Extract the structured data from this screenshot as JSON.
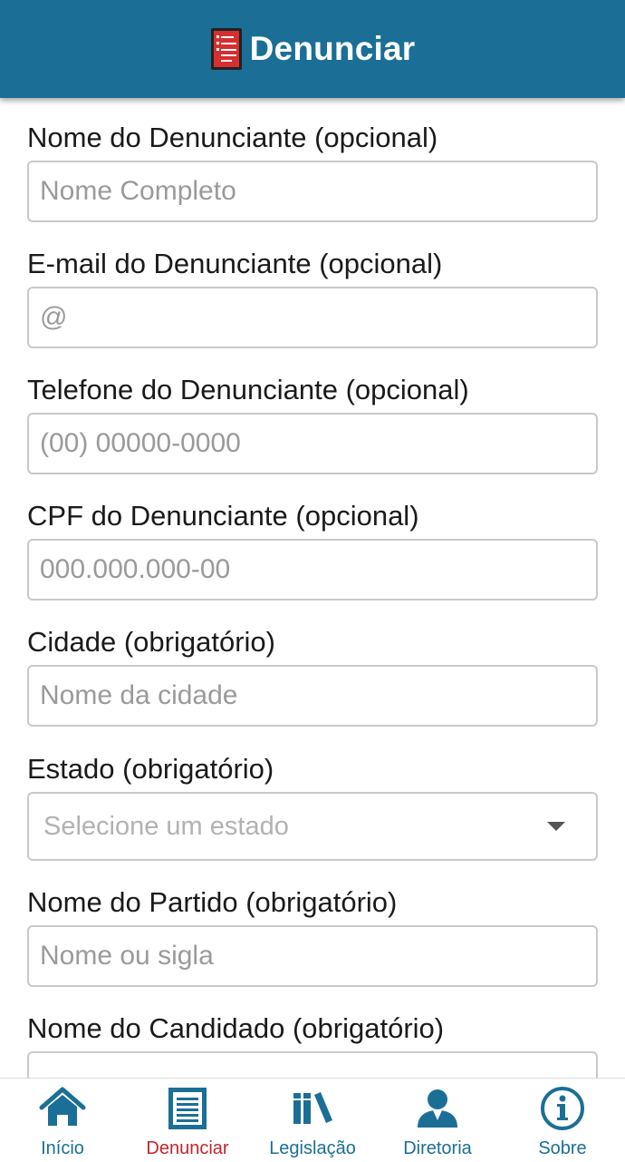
{
  "header": {
    "title": "Denunciar",
    "icon": "report-form-icon"
  },
  "form": {
    "fields": [
      {
        "label": "Nome do Denunciante (opcional)",
        "placeholder": "Nome Completo",
        "value": ""
      },
      {
        "label": "E-mail do Denunciante (opcional)",
        "placeholder": "@",
        "value": ""
      },
      {
        "label": "Telefone do Denunciante (opcional)",
        "placeholder": "(00) 00000-0000",
        "value": ""
      },
      {
        "label": "CPF do Denunciante (opcional)",
        "placeholder": "000.000.000-00",
        "value": ""
      },
      {
        "label": "Cidade (obrigatório)",
        "placeholder": "Nome da cidade",
        "value": ""
      },
      {
        "label": "Estado (obrigatório)",
        "selected": "Selecione um estado"
      },
      {
        "label": "Nome do Partido (obrigatório)",
        "placeholder": "Nome ou sigla",
        "value": ""
      },
      {
        "label": "Nome do Candidado (obrigatório)",
        "placeholder": "",
        "value": ""
      }
    ]
  },
  "nav": {
    "items": [
      {
        "label": "Início",
        "icon": "home-icon"
      },
      {
        "label": "Denunciar",
        "icon": "document-icon",
        "active": true
      },
      {
        "label": "Legislação",
        "icon": "books-icon"
      },
      {
        "label": "Diretoria",
        "icon": "person-icon"
      },
      {
        "label": "Sobre",
        "icon": "info-icon"
      }
    ]
  },
  "colors": {
    "primary": "#1b6f96",
    "active": "#c0262c",
    "border": "#c9c9c9",
    "placeholder": "#9a9a9a"
  }
}
